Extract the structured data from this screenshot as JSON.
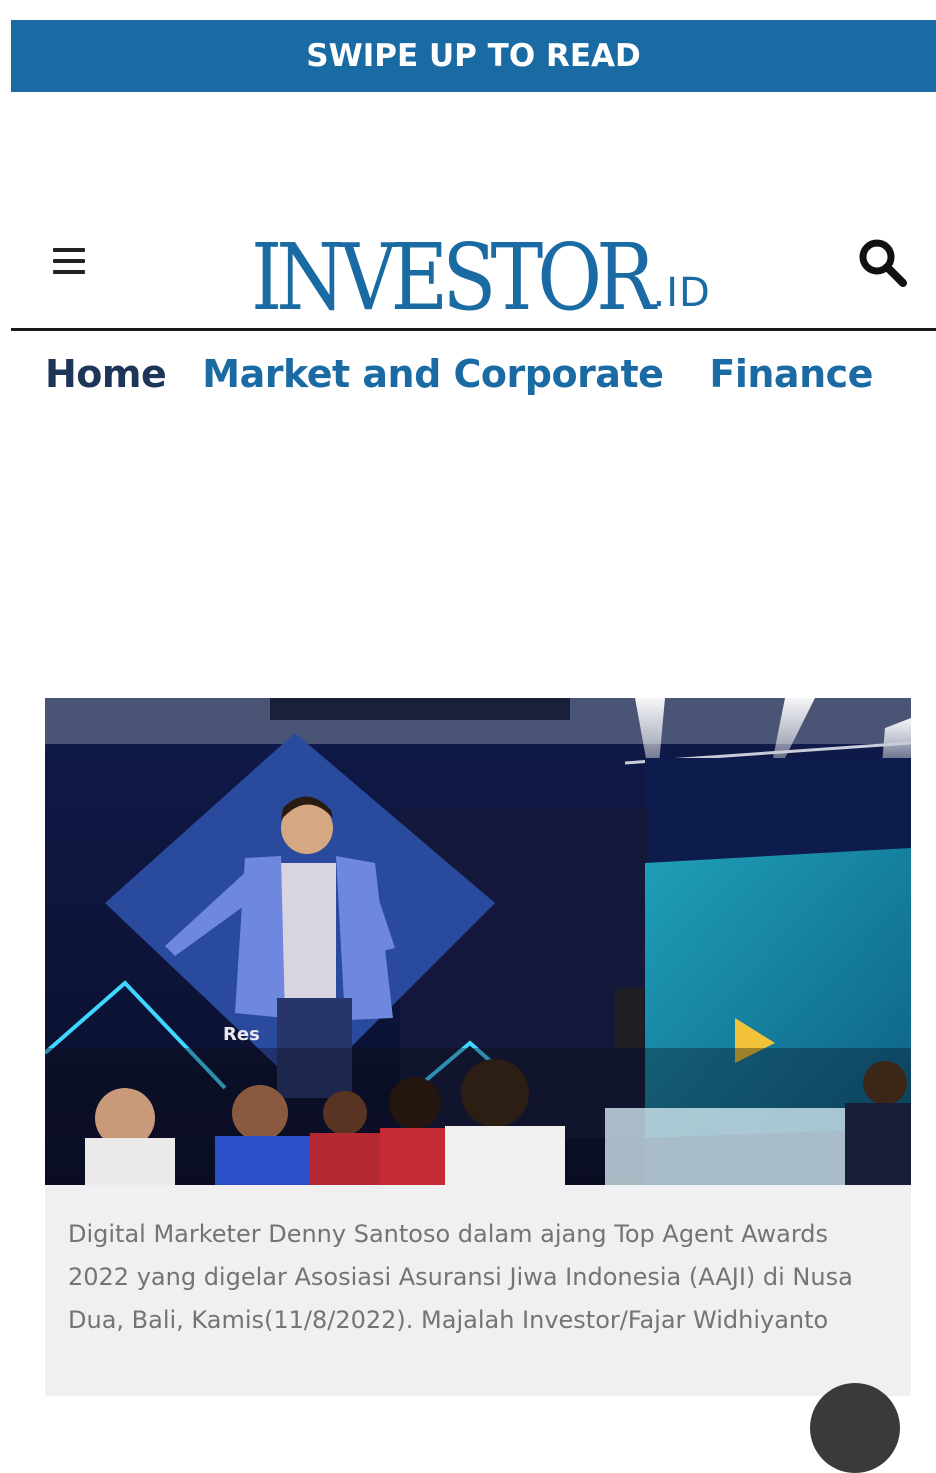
{
  "banner": {
    "text": "SWIPE UP TO READ",
    "color": "#1a6aa3"
  },
  "header": {
    "logo_main": "INVESTOR",
    "logo_suffix": ".ID",
    "menu_icon": "hamburger-menu-icon",
    "search_icon": "search-icon"
  },
  "nav": {
    "items": [
      {
        "label": "Home",
        "color": "#1d3557"
      },
      {
        "label": "Market and Corporate",
        "color": "#1a6aa3"
      },
      {
        "label": "Finance",
        "color": "#1a6aa3"
      }
    ]
  },
  "article": {
    "photo_alt": "Speaker on stage at Top Agent Awards 2022",
    "caption": "Digital Marketer Denny Santoso dalam ajang Top Agent Awards 2022 yang digelar Asosiasi Asuransi Jiwa Indonesia (AAJI) di Nusa Dua, Bali, Kamis(11/8/2022). Majalah Investor/Fajar Widhiyanto"
  }
}
